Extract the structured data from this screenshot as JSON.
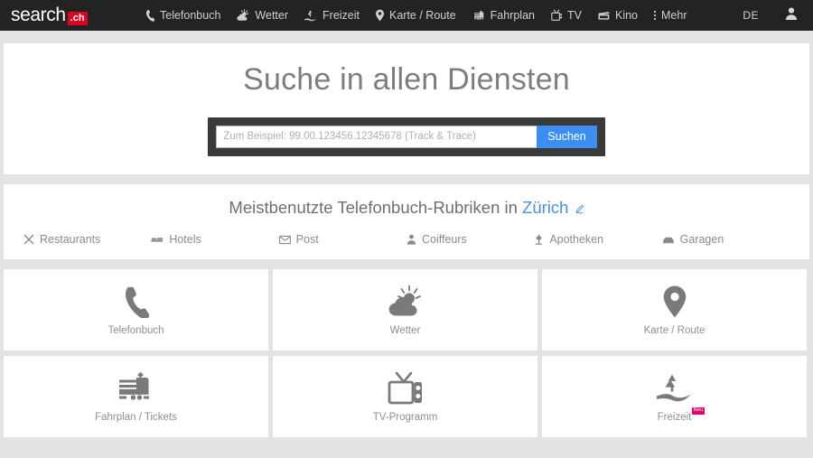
{
  "navbar": {
    "brand": {
      "word": "search",
      "tld": ".ch"
    },
    "items": [
      {
        "label": "Telefonbuch",
        "icon": "phone-icon"
      },
      {
        "label": "Wetter",
        "icon": "weather-icon"
      },
      {
        "label": "Freizeit",
        "icon": "leisure-icon"
      },
      {
        "label": "Karte / Route",
        "icon": "map-pin-icon"
      },
      {
        "label": "Fahrplan",
        "icon": "train-icon"
      },
      {
        "label": "TV",
        "icon": "tv-icon"
      },
      {
        "label": "Kino",
        "icon": "cinema-icon"
      },
      {
        "label": "Mehr",
        "icon": "kebab-menu-icon"
      }
    ],
    "language": "DE",
    "account_icon": "user-icon"
  },
  "search": {
    "title": "Suche in allen Diensten",
    "placeholder": "Zum Beispiel: 99.00.123456.12345678 (Track & Trace)",
    "value": "",
    "button_label": "Suchen",
    "button_color": "#3d8ef2"
  },
  "rubrics": {
    "title_prefix": "Meistbenutzte Telefonbuch-Rubriken in ",
    "city": "Zürich",
    "city_color": "#4a90d9",
    "edit_icon": "pencil-icon",
    "items": [
      {
        "label": "Restaurants",
        "icon": "cutlery-icon"
      },
      {
        "label": "Hotels",
        "icon": "bed-icon"
      },
      {
        "label": "Post",
        "icon": "envelope-icon"
      },
      {
        "label": "Coiffeurs",
        "icon": "person-icon"
      },
      {
        "label": "Apotheken",
        "icon": "pharmacy-icon"
      },
      {
        "label": "Garagen",
        "icon": "car-icon"
      }
    ]
  },
  "tiles": [
    {
      "label": "Telefonbuch",
      "icon": "phone-handset-icon",
      "badge": ""
    },
    {
      "label": "Wetter",
      "icon": "sun-cloud-icon",
      "badge": ""
    },
    {
      "label": "Karte / Route",
      "icon": "map-pin-icon",
      "badge": ""
    },
    {
      "label": "Fahrplan / Tickets",
      "icon": "locomotive-icon",
      "badge": ""
    },
    {
      "label": "TV-Programm",
      "icon": "retro-tv-icon",
      "badge": ""
    },
    {
      "label": "Freizeit",
      "icon": "tree-path-icon",
      "badge": "Neu",
      "badge_color": "#e5006d"
    }
  ]
}
